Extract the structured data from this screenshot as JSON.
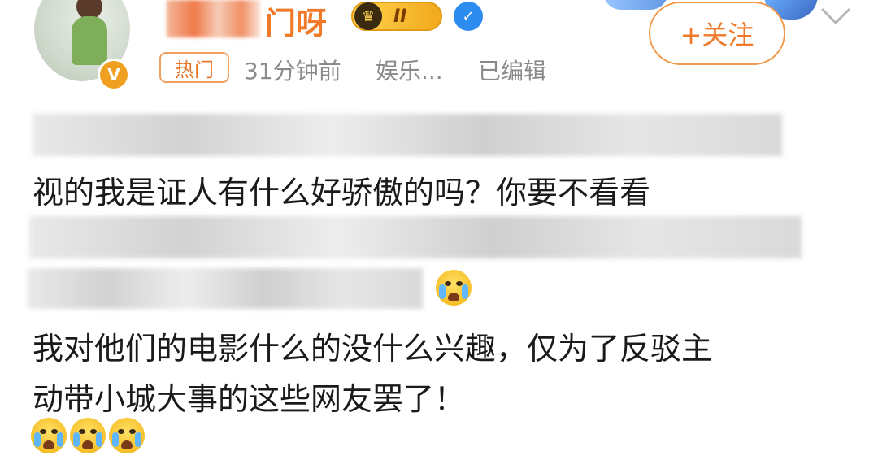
{
  "header": {
    "username_suffix": "门呀",
    "vip_level": "II",
    "follow_label": "+关注",
    "verify_mark": "V",
    "vip_crown": "♛",
    "blue_badge_mark": "✓"
  },
  "meta": {
    "hot_tag": "热门",
    "time": "31分钟前",
    "source": "娱乐...",
    "edited": "已编辑"
  },
  "post": {
    "line2": "视的我是证人有什么好骄傲的吗？你要不看看",
    "line5": "我对他们的电影什么的没什么兴趣，仅为了反驳主",
    "line6": "动带小城大事的这些网友罢了！"
  },
  "icons": {
    "avatar": "avatar-image",
    "verify": "orange-verified-icon",
    "vip": "vip-crown-icon",
    "blue_v": "blue-verified-icon",
    "chevron": "chevron-down-icon",
    "emoji": "crying-face-emoji"
  },
  "colors": {
    "accent": "#f07a2a",
    "meta_gray": "#8a8a8a",
    "text": "#1a1a1a"
  }
}
